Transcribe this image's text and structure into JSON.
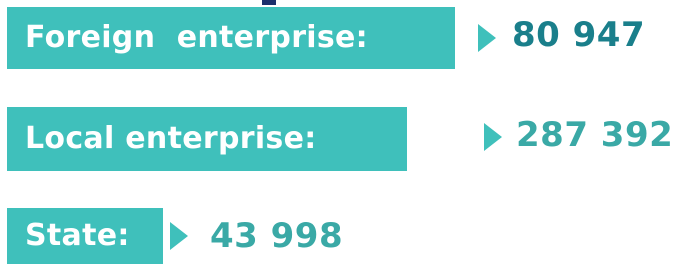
{
  "colors": {
    "label_fill": "#3fc0bb",
    "value_dark_teal": "#1a7f8b",
    "value_light_teal": "#3aa9a6",
    "accent_navy": "#1b2f6b"
  },
  "rows": [
    {
      "label": "Foreign  enterprise:",
      "value": "80 947"
    },
    {
      "label": "Local enterprise:",
      "value": "287 392"
    },
    {
      "label": "State:",
      "value": "43 998"
    }
  ]
}
